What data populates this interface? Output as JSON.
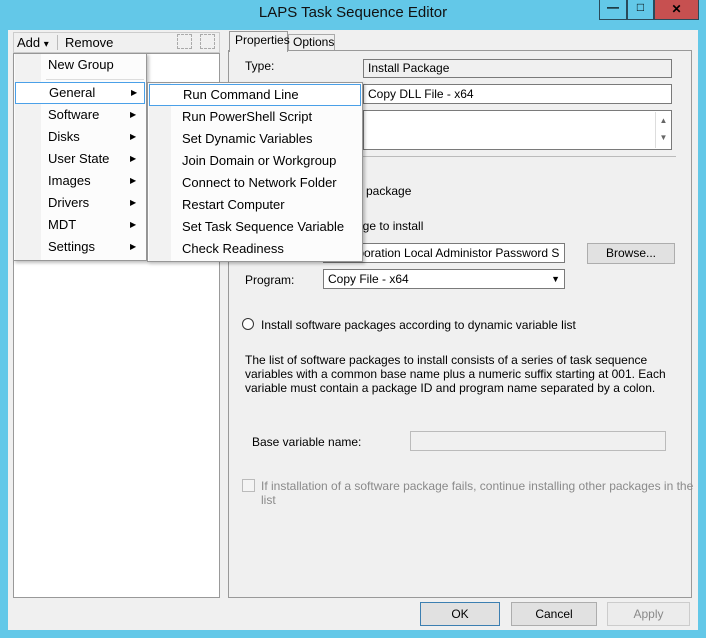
{
  "window": {
    "title": "LAPS Task Sequence Editor",
    "minimize": "—",
    "maximize": "□",
    "close": "✕",
    "close_color": "#c75050"
  },
  "toolbar": {
    "add": "Add",
    "add_arrow": "▾",
    "remove": "Remove"
  },
  "add_menu": {
    "items": [
      {
        "label": "New Group"
      },
      {
        "label": "General"
      },
      {
        "label": "Software"
      },
      {
        "label": "Disks"
      },
      {
        "label": "User State"
      },
      {
        "label": "Images"
      },
      {
        "label": "Drivers"
      },
      {
        "label": "MDT"
      },
      {
        "label": "Settings"
      }
    ],
    "selected": "General"
  },
  "general_submenu": {
    "items": [
      {
        "label": "Run Command Line"
      },
      {
        "label": "Run PowerShell Script"
      },
      {
        "label": "Set Dynamic Variables"
      },
      {
        "label": "Join Domain or Workgroup"
      },
      {
        "label": "Connect to Network Folder"
      },
      {
        "label": "Restart Computer"
      },
      {
        "label": "Set Task Sequence Variable"
      },
      {
        "label": "Check Readiness"
      }
    ],
    "selected": "Run Command Line"
  },
  "tabs": [
    {
      "label": "Properties"
    },
    {
      "label": "Options"
    }
  ],
  "properties": {
    "type_label": "Type:",
    "type_value": "Install Package",
    "name_value": "Copy DLL File - x64",
    "radio1_fragment": "e package",
    "package_label_fragment": "age to install",
    "package_value": "ft Corporation Local Administor Password S",
    "browse": "Browse...",
    "program_label": "Program:",
    "program_value": "Copy File - x64",
    "radio2": "Install software packages according to dynamic variable list",
    "description": "The list of software packages to install consists of a series of task sequence variables with a common base name plus a numeric suffix starting at 001.  Each variable must contain a package ID and program name separated by a colon.",
    "base_var_label": "Base variable name:",
    "base_var_value": "",
    "continue_checkbox": "If installation of a software package fails, continue installing other packages in the list",
    "continue_checked": false
  },
  "footer": {
    "ok": "OK",
    "cancel": "Cancel",
    "apply": "Apply"
  }
}
